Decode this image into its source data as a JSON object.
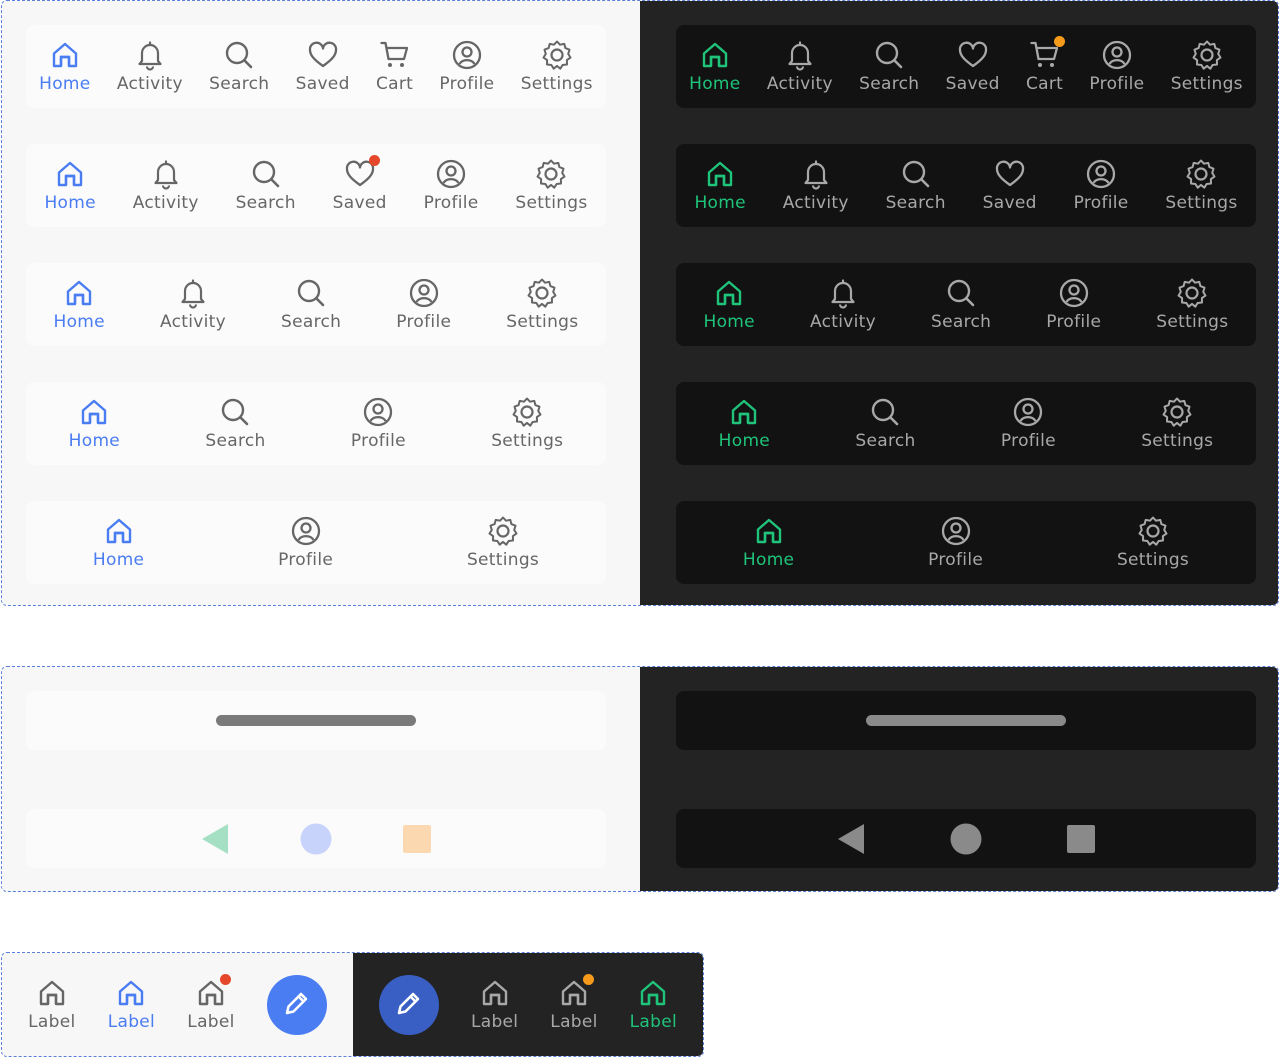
{
  "colors": {
    "light_active": "#4a7cf2",
    "dark_active": "#1fc37a",
    "badge_red": "#e5472b",
    "badge_orange": "#f59a1b",
    "fab_light": "#4a7cf2",
    "fab_dark": "#3a5fc4"
  },
  "nav_bars": {
    "bar7": [
      {
        "label": "Home",
        "icon": "home-icon"
      },
      {
        "label": "Activity",
        "icon": "bell-icon"
      },
      {
        "label": "Search",
        "icon": "search-icon"
      },
      {
        "label": "Saved",
        "icon": "heart-icon"
      },
      {
        "label": "Cart",
        "icon": "cart-icon"
      },
      {
        "label": "Profile",
        "icon": "profile-icon"
      },
      {
        "label": "Settings",
        "icon": "gear-icon"
      }
    ],
    "bar6": [
      {
        "label": "Home",
        "icon": "home-icon"
      },
      {
        "label": "Activity",
        "icon": "bell-icon"
      },
      {
        "label": "Search",
        "icon": "search-icon"
      },
      {
        "label": "Saved",
        "icon": "heart-icon"
      },
      {
        "label": "Profile",
        "icon": "profile-icon"
      },
      {
        "label": "Settings",
        "icon": "gear-icon"
      }
    ],
    "bar5": [
      {
        "label": "Home",
        "icon": "home-icon"
      },
      {
        "label": "Activity",
        "icon": "bell-icon"
      },
      {
        "label": "Search",
        "icon": "search-icon"
      },
      {
        "label": "Profile",
        "icon": "profile-icon"
      },
      {
        "label": "Settings",
        "icon": "gear-icon"
      }
    ],
    "bar4": [
      {
        "label": "Home",
        "icon": "home-icon"
      },
      {
        "label": "Search",
        "icon": "search-icon"
      },
      {
        "label": "Profile",
        "icon": "profile-icon"
      },
      {
        "label": "Settings",
        "icon": "gear-icon"
      }
    ],
    "bar3": [
      {
        "label": "Home",
        "icon": "home-icon"
      },
      {
        "label": "Profile",
        "icon": "profile-icon"
      },
      {
        "label": "Settings",
        "icon": "gear-icon"
      }
    ]
  },
  "system_nav": {
    "light": {
      "back_color": "#a6e0c4",
      "home_color": "#c8d3fb",
      "recents_color": "#fbd8b0"
    },
    "dark": {
      "back_color": "#8a8a8a",
      "home_color": "#8a8a8a",
      "recents_color": "#8a8a8a"
    }
  },
  "compact_bar": {
    "light_items": [
      {
        "label": "Label",
        "state": "default"
      },
      {
        "label": "Label",
        "state": "active"
      },
      {
        "label": "Label",
        "state": "badge"
      }
    ],
    "dark_items": [
      {
        "label": "Label",
        "state": "default"
      },
      {
        "label": "Label",
        "state": "badge"
      },
      {
        "label": "Label",
        "state": "active"
      }
    ],
    "fab_icon": "pencil-icon"
  }
}
